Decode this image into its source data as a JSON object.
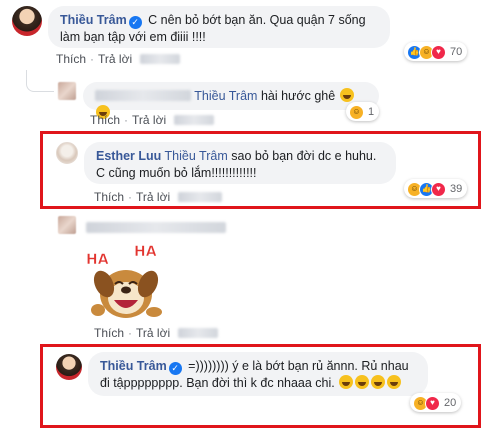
{
  "actions": {
    "like": "Thích",
    "reply": "Trả lời",
    "dot": "·"
  },
  "comments": [
    {
      "author": "Thiều Trâm",
      "verified": true,
      "text": "C nên bỏ bớt bạn ăn. Qua quận 7 sống làm bạn tập với em điiii !!!!",
      "reactions": [
        "like",
        "haha",
        "heart"
      ],
      "reaction_count": "70"
    },
    {
      "author": "",
      "tag": "Thiều Trâm",
      "text": "hài hước ghê",
      "emoji": [
        "smiling-face",
        "smiling-face"
      ],
      "reactions": [
        "haha"
      ],
      "reaction_count": "1"
    },
    {
      "author": "Esther Luu",
      "tag": "Thiều Trâm",
      "text": "sao bỏ bạn đời dc e huhu. C cũng muốn bỏ lắm!!!!!!!!!!!!!",
      "reactions": [
        "haha",
        "like",
        "heart"
      ],
      "reaction_count": "39",
      "highlighted": true
    },
    {
      "author": "",
      "sticker": "HA HA",
      "sticker_icon": "laughing-dog-sticker"
    },
    {
      "author": "Thiều Trâm",
      "verified": true,
      "text": "=)))))))) ý e là bớt bạn rủ ănnn. Rủ nhau đi tậpppppppp. Bạn đời thì k đc nhaaa chi.",
      "emoji": [
        "rolling-laughing-face",
        "rolling-laughing-face",
        "rolling-laughing-face",
        "rolling-laughing-face"
      ],
      "reactions": [
        "haha",
        "heart"
      ],
      "reaction_count": "20",
      "highlighted": true
    }
  ],
  "colors": {
    "highlight": "#e0151b",
    "link": "#385898",
    "bubble": "#f2f3f5"
  }
}
